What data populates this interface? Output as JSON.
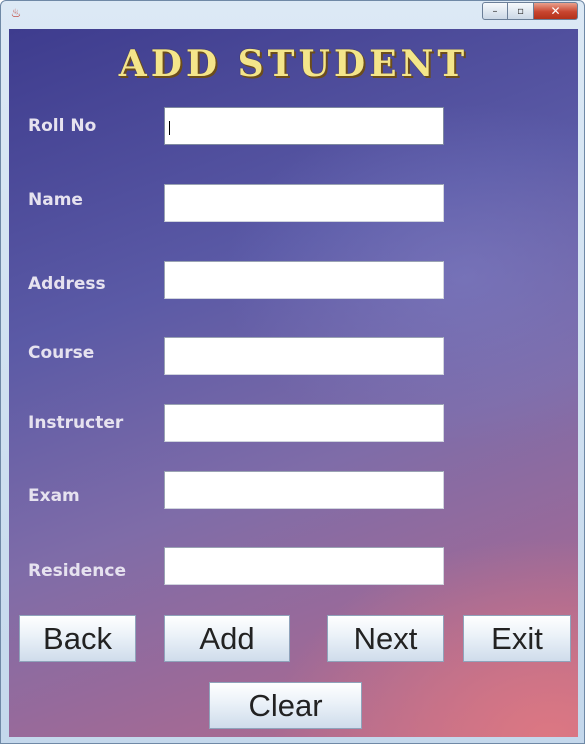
{
  "window": {
    "app_icon": "java-cup-icon",
    "controls": {
      "minimize": "–",
      "maximize": "▫",
      "close": "✕"
    }
  },
  "form": {
    "heading": "ADD STUDENT",
    "fields": [
      {
        "label": "Roll No",
        "value": ""
      },
      {
        "label": "Name",
        "value": ""
      },
      {
        "label": "Address",
        "value": ""
      },
      {
        "label": "Course",
        "value": ""
      },
      {
        "label": "Instructer",
        "value": ""
      },
      {
        "label": "Exam",
        "value": ""
      },
      {
        "label": "Residence",
        "value": ""
      }
    ]
  },
  "buttons": {
    "back": "Back",
    "add": "Add",
    "next": "Next",
    "exit": "Exit",
    "clear": "Clear"
  },
  "colors": {
    "heading_text": "#f4e58a",
    "label_text": "#e6e2ef",
    "background_top": "#3e3c8e",
    "background_bottom": "#bb6c8a"
  }
}
